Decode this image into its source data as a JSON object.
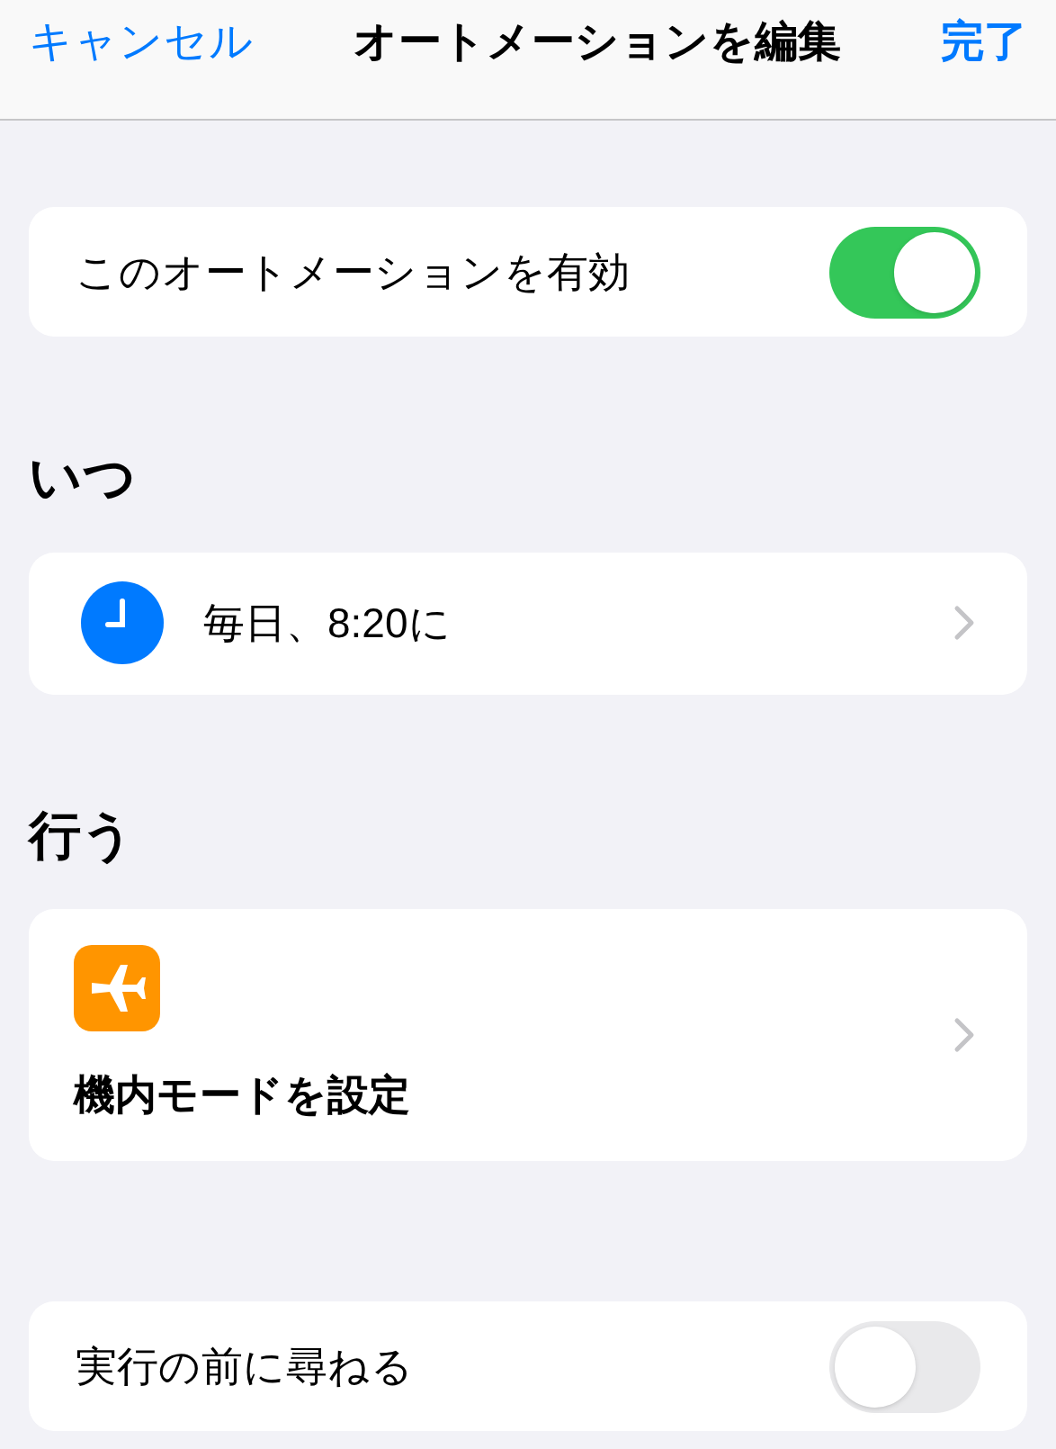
{
  "nav": {
    "cancel": "キャンセル",
    "title": "オートメーションを編集",
    "done": "完了"
  },
  "enable": {
    "label": "このオートメーションを有効",
    "on": true
  },
  "when": {
    "heading": "いつ",
    "trigger": "毎日、8:20に"
  },
  "do": {
    "heading": "行う",
    "action": "機内モードを設定"
  },
  "ask": {
    "label": "実行の前に尋ねる",
    "on": false
  }
}
